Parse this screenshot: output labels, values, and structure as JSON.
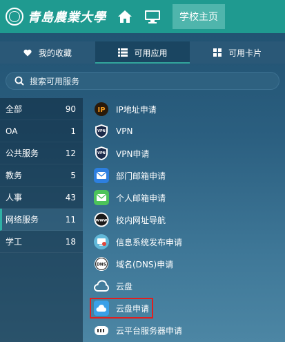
{
  "header": {
    "logo_text": "青島農業大學",
    "school_home_label": "学校主页"
  },
  "tabs": [
    {
      "label": "我的收藏",
      "icon": "heart-icon"
    },
    {
      "label": "可用应用",
      "icon": "list-icon"
    },
    {
      "label": "可用卡片",
      "icon": "grid-icon"
    }
  ],
  "search": {
    "placeholder": "搜索可用服务"
  },
  "categories": [
    {
      "label": "全部",
      "count": "90"
    },
    {
      "label": "OA",
      "count": "1"
    },
    {
      "label": "公共服务",
      "count": "12"
    },
    {
      "label": "教务",
      "count": "5"
    },
    {
      "label": "人事",
      "count": "43"
    },
    {
      "label": "网络服务",
      "count": "11"
    },
    {
      "label": "学工",
      "count": "18"
    }
  ],
  "active_category": "网络服务",
  "apps": [
    {
      "label": "IP地址申请",
      "icon": "ip-icon"
    },
    {
      "label": "VPN",
      "icon": "vpn-shield-icon"
    },
    {
      "label": "VPN申请",
      "icon": "vpn-shield-icon"
    },
    {
      "label": "部门邮箱申请",
      "icon": "mail-icon"
    },
    {
      "label": "个人邮箱申请",
      "icon": "mail-icon"
    },
    {
      "label": "校内网址导航",
      "icon": "www-icon"
    },
    {
      "label": "信息系统发布申请",
      "icon": "monitor-publish-icon"
    },
    {
      "label": "域名(DNS)申请",
      "icon": "dns-icon"
    },
    {
      "label": "云盘",
      "icon": "cloud-icon"
    },
    {
      "label": "云盘申请",
      "icon": "cloud-icon"
    },
    {
      "label": "云平台服务器申请",
      "icon": "server-icon"
    }
  ],
  "colors": {
    "header": "#1f9a90",
    "accent": "#2fb1a5",
    "highlight_border": "#e11f1f"
  }
}
